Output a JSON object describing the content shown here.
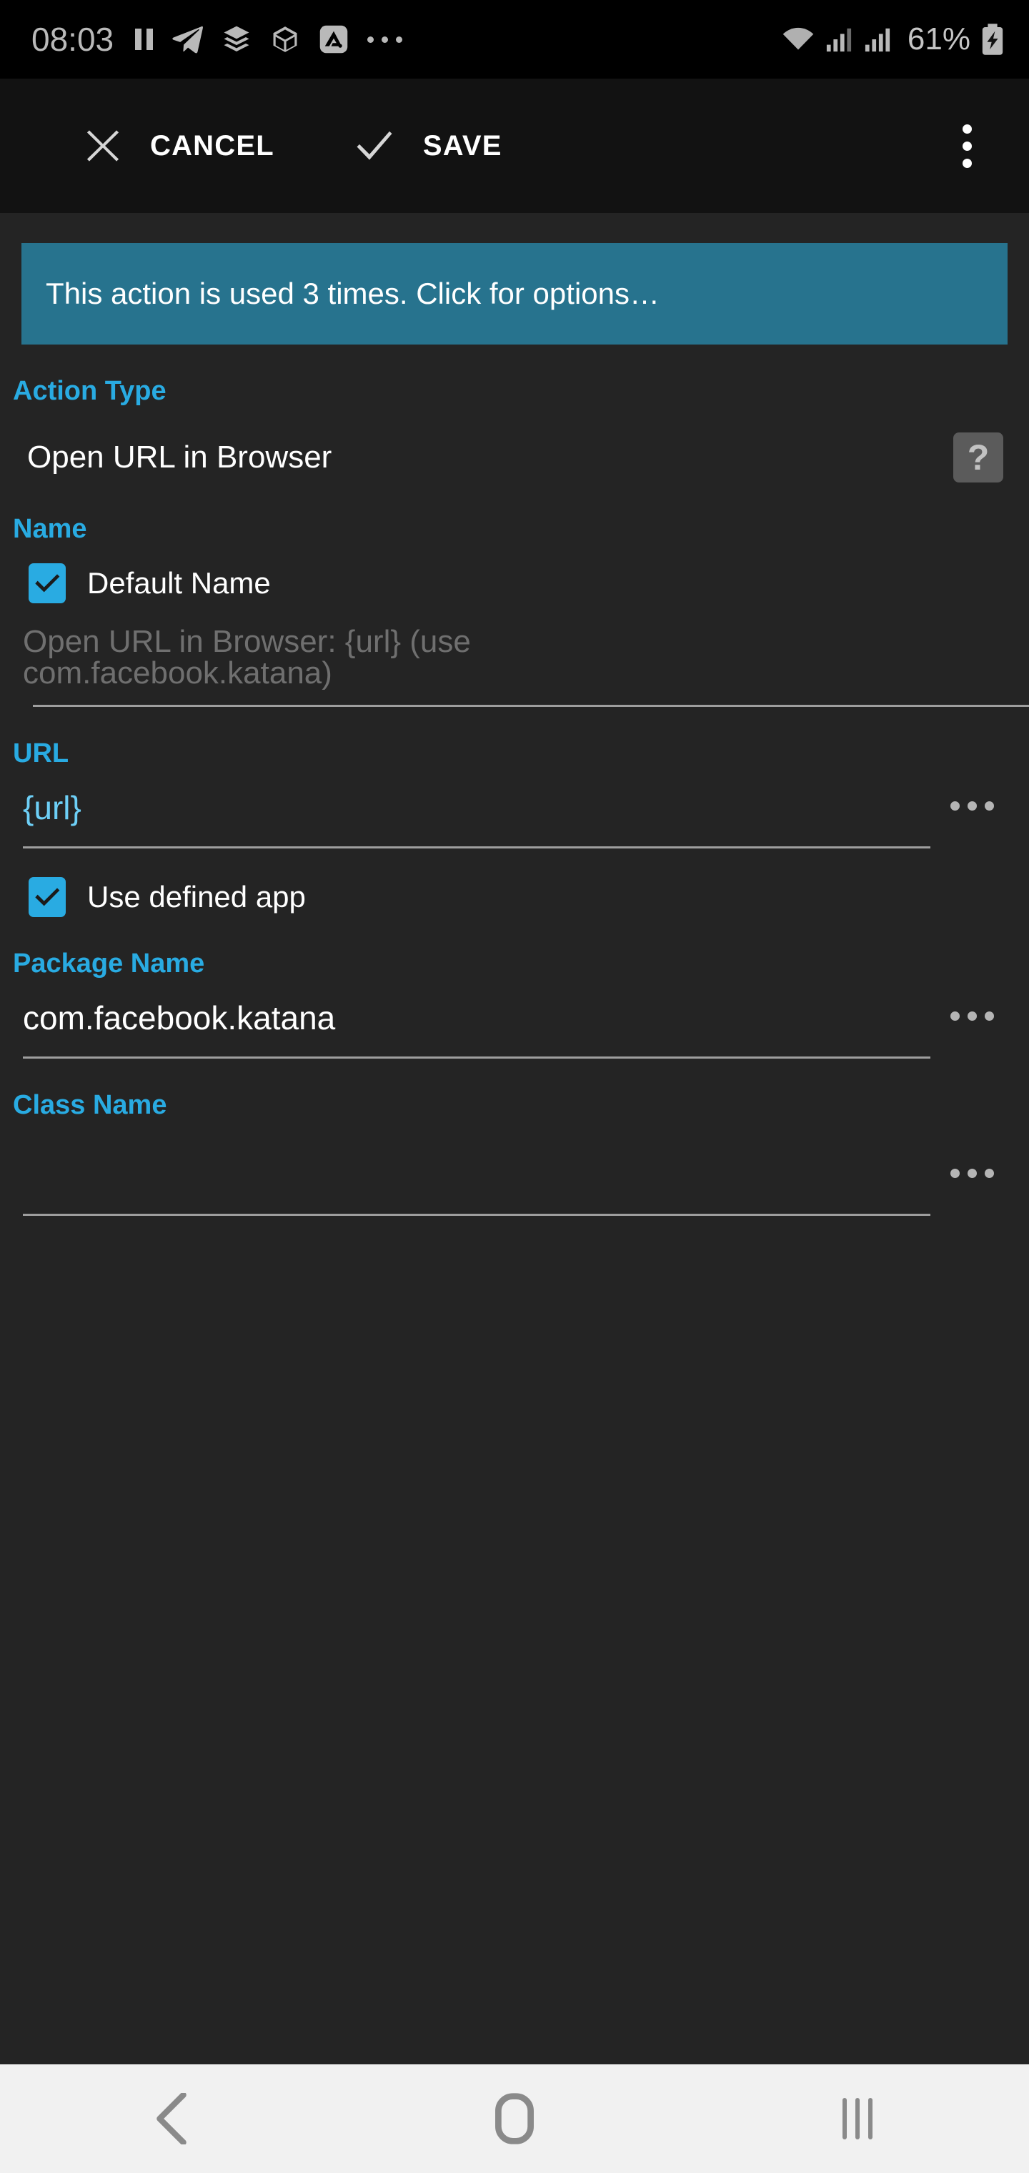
{
  "status_bar": {
    "time": "08:03",
    "battery_percent": "61%",
    "icons_left": [
      "pause-icon",
      "telegram-icon",
      "layers-icon",
      "cube-icon",
      "autotools-icon",
      "more-dots-icon"
    ],
    "icons_right": [
      "wifi-icon",
      "signal-icon",
      "signal-icon",
      "battery-charging-icon"
    ]
  },
  "toolbar": {
    "cancel_label": "CANCEL",
    "save_label": "SAVE",
    "cancel_icon": "close-icon",
    "save_icon": "check-icon",
    "overflow_icon": "overflow-menu-icon"
  },
  "banner": {
    "text": "This action is used 3 times. Click for options…",
    "background": "#27738e"
  },
  "fields": {
    "action_type": {
      "label": "Action Type",
      "value": "Open URL in Browser",
      "help_icon": "help-question-icon"
    },
    "name": {
      "label": "Name",
      "default_name_checkbox": {
        "label": "Default Name",
        "checked": true
      },
      "preview_placeholder": "Open URL in Browser: {url} (use com.facebook.katana)"
    },
    "url": {
      "label": "URL",
      "value": "{url}",
      "more_icon": "ellipsis-icon"
    },
    "use_defined_app": {
      "label": "Use defined app",
      "checked": true
    },
    "package_name": {
      "label": "Package Name",
      "value": "com.facebook.katana",
      "more_icon": "ellipsis-icon"
    },
    "class_name": {
      "label": "Class Name",
      "value": "",
      "more_icon": "ellipsis-icon"
    }
  },
  "nav_bar": {
    "back_icon": "back-chevron-icon",
    "home_icon": "home-square-icon",
    "recents_icon": "recents-bars-icon"
  },
  "colors": {
    "accent": "#29abe2",
    "variable_text": "#6dcff6",
    "background": "#242424",
    "toolbar_background": "#121212",
    "banner": "#27738e"
  }
}
